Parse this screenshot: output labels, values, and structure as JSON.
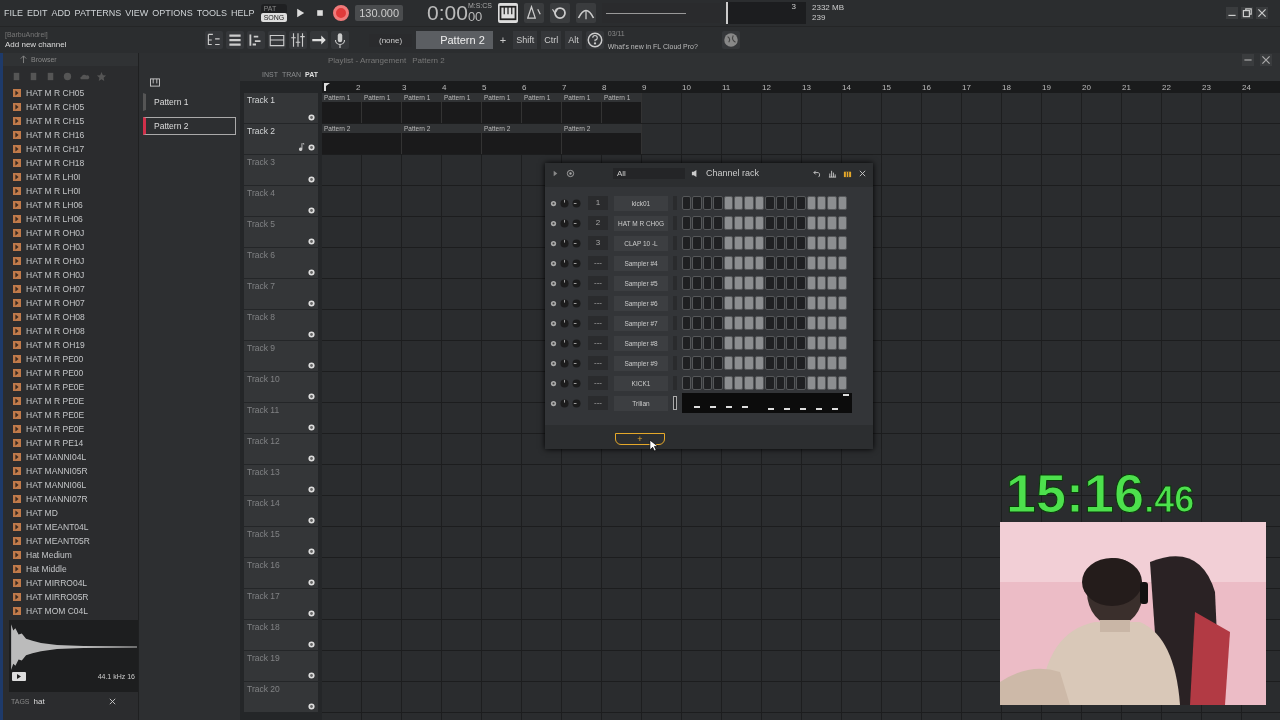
{
  "menu": [
    "FILE",
    "EDIT",
    "ADD",
    "PATTERNS",
    "VIEW",
    "OPTIONS",
    "TOOLS",
    "HELP"
  ],
  "transport": {
    "modes": [
      {
        "label": "PAT",
        "selected": false
      },
      {
        "label": "SONG",
        "selected": true
      }
    ],
    "recording": true,
    "tempo": "130.000",
    "time_main": "0:00",
    "time_cs": "00",
    "time_unit": "M:S:CS",
    "meter_value": "3",
    "memory": "2332 MB",
    "cpu": "239"
  },
  "hint": {
    "user": "[BarbuAndrei]",
    "text": "Add new channel"
  },
  "toolbar": {
    "channel": "(none)",
    "pattern": "Pattern 2",
    "add": "+",
    "keys": [
      "Shift",
      "Ctrl",
      "Alt"
    ],
    "news_date": "03/11",
    "news": "What's new in FL Cloud Pro?"
  },
  "browser": {
    "title": "Browser",
    "items": [
      "HAT M R CH05",
      "HAT M R CH05",
      "HAT M R CH15",
      "HAT M R CH16",
      "HAT M R CH17",
      "HAT M R CH18",
      "HAT M R LH0I",
      "HAT M R LH0I",
      "HAT M R LH06",
      "HAT M R LH06",
      "HAT M R OH0J",
      "HAT M R OH0J",
      "HAT M R OH0J",
      "HAT M R OH0J",
      "HAT M R OH07",
      "HAT M R OH07",
      "HAT M R OH08",
      "HAT M R OH08",
      "HAT M R OH19",
      "HAT M R PE00",
      "HAT M R PE00",
      "HAT M R PE0E",
      "HAT M R PE0E",
      "HAT M R PE0E",
      "HAT M R PE0E",
      "HAT M R PE14",
      "HAT MANNI04L",
      "HAT MANNI05R",
      "HAT MANNI06L",
      "HAT MANNI07R",
      "HAT MD",
      "HAT MEANT04L",
      "HAT MEANT05R",
      "Hat Medium",
      "Hat Middle",
      "HAT MIRRO04L",
      "HAT MIRRO05R",
      "HAT MOM C04L"
    ],
    "sample_info": "44.1 kHz 16",
    "tags_label": "TAGS",
    "tags_value": "hat"
  },
  "patterns": [
    {
      "label": "Pattern 1",
      "selected": false
    },
    {
      "label": "Pattern 2",
      "selected": true
    }
  ],
  "playlist": {
    "title": "Playlist - Arrangement",
    "crumb": "Pattern 2",
    "modes": [
      {
        "label": "INST",
        "selected": false
      },
      {
        "label": "TRAN",
        "selected": false
      },
      {
        "label": "PAT",
        "selected": true
      }
    ],
    "ruler": [
      "2",
      "3",
      "4",
      "5",
      "6",
      "7",
      "8",
      "9",
      "10",
      "11",
      "12",
      "13",
      "14",
      "15",
      "16",
      "17",
      "18",
      "19",
      "20",
      "21",
      "22",
      "23",
      "24"
    ],
    "tracks": [
      {
        "name": "Track 1",
        "active": true,
        "kind": "drums",
        "clips": [
          "Pattern 1",
          "Pattern 1",
          "Pattern 1",
          "Pattern 1",
          "Pattern 1",
          "Pattern 1",
          "Pattern 1",
          "Pattern 1"
        ]
      },
      {
        "name": "Track 2",
        "active": true,
        "kind": "notes",
        "clips": [
          "Pattern 2",
          "Pattern 2",
          "Pattern 2",
          "Pattern 2"
        ]
      },
      {
        "name": "Track 3",
        "active": false,
        "kind": "drums"
      },
      {
        "name": "Track 4",
        "active": false,
        "kind": "drums"
      },
      {
        "name": "Track 5",
        "active": false,
        "kind": "drums"
      },
      {
        "name": "Track 6",
        "active": false,
        "kind": "drums"
      },
      {
        "name": "Track 7",
        "active": false,
        "kind": "drums"
      },
      {
        "name": "Track 8",
        "active": false,
        "kind": "drums"
      },
      {
        "name": "Track 9",
        "active": false,
        "kind": "drums"
      },
      {
        "name": "Track 10",
        "active": false,
        "kind": "drums"
      },
      {
        "name": "Track 11",
        "active": false,
        "kind": "drums"
      },
      {
        "name": "Track 12",
        "active": false,
        "kind": "drums"
      },
      {
        "name": "Track 13",
        "active": false,
        "kind": "drums"
      },
      {
        "name": "Track 14",
        "active": false,
        "kind": "drums"
      },
      {
        "name": "Track 15",
        "active": false,
        "kind": "drums"
      },
      {
        "name": "Track 16",
        "active": false,
        "kind": "drums"
      },
      {
        "name": "Track 17",
        "active": false,
        "kind": "drums"
      },
      {
        "name": "Track 18",
        "active": false,
        "kind": "drums"
      },
      {
        "name": "Track 19",
        "active": false,
        "kind": "drums"
      },
      {
        "name": "Track 20",
        "active": false,
        "kind": "drums"
      }
    ]
  },
  "channel_rack": {
    "filter": "All",
    "title": "Channel rack",
    "add": "+",
    "channels": [
      {
        "number": "1",
        "name": "kick01",
        "kind": "steps",
        "steps": [
          false,
          false,
          false,
          false,
          true,
          true,
          true,
          true,
          false,
          false,
          false,
          false,
          true,
          true,
          true,
          true
        ]
      },
      {
        "number": "2",
        "name": "HAT M R CH0G",
        "kind": "steps",
        "steps": [
          false,
          false,
          false,
          false,
          true,
          true,
          true,
          true,
          false,
          false,
          false,
          false,
          true,
          true,
          true,
          true
        ]
      },
      {
        "number": "3",
        "name": "CLAP 10  -L",
        "kind": "steps",
        "steps": [
          false,
          false,
          false,
          false,
          true,
          true,
          true,
          true,
          false,
          false,
          false,
          false,
          true,
          true,
          true,
          true
        ]
      },
      {
        "number": "---",
        "name": "Sampler #4",
        "kind": "steps",
        "steps": [
          false,
          false,
          false,
          false,
          true,
          true,
          true,
          true,
          false,
          false,
          false,
          false,
          true,
          true,
          true,
          true
        ]
      },
      {
        "number": "---",
        "name": "Sampler #5",
        "kind": "steps",
        "steps": [
          false,
          false,
          false,
          false,
          true,
          true,
          true,
          true,
          false,
          false,
          false,
          false,
          true,
          true,
          true,
          true
        ]
      },
      {
        "number": "---",
        "name": "Sampler #6",
        "kind": "steps",
        "steps": [
          false,
          false,
          false,
          false,
          true,
          true,
          true,
          true,
          false,
          false,
          false,
          false,
          true,
          true,
          true,
          true
        ]
      },
      {
        "number": "---",
        "name": "Sampler #7",
        "kind": "steps",
        "steps": [
          false,
          false,
          false,
          false,
          true,
          true,
          true,
          true,
          false,
          false,
          false,
          false,
          true,
          true,
          true,
          true
        ]
      },
      {
        "number": "---",
        "name": "Sampler #8",
        "kind": "steps",
        "steps": [
          false,
          false,
          false,
          false,
          true,
          true,
          true,
          true,
          false,
          false,
          false,
          false,
          true,
          true,
          true,
          true
        ]
      },
      {
        "number": "---",
        "name": "Sampler #9",
        "kind": "steps",
        "steps": [
          false,
          false,
          false,
          false,
          true,
          true,
          true,
          true,
          false,
          false,
          false,
          false,
          true,
          true,
          true,
          true
        ]
      },
      {
        "number": "---",
        "name": "KICK1",
        "kind": "steps",
        "steps": [
          false,
          false,
          false,
          false,
          true,
          true,
          true,
          true,
          false,
          false,
          false,
          false,
          true,
          true,
          true,
          true
        ]
      },
      {
        "number": "---",
        "name": "Trilian",
        "kind": "pianoroll"
      }
    ]
  },
  "timer": {
    "main": "15:16",
    "fraction": ".46"
  }
}
